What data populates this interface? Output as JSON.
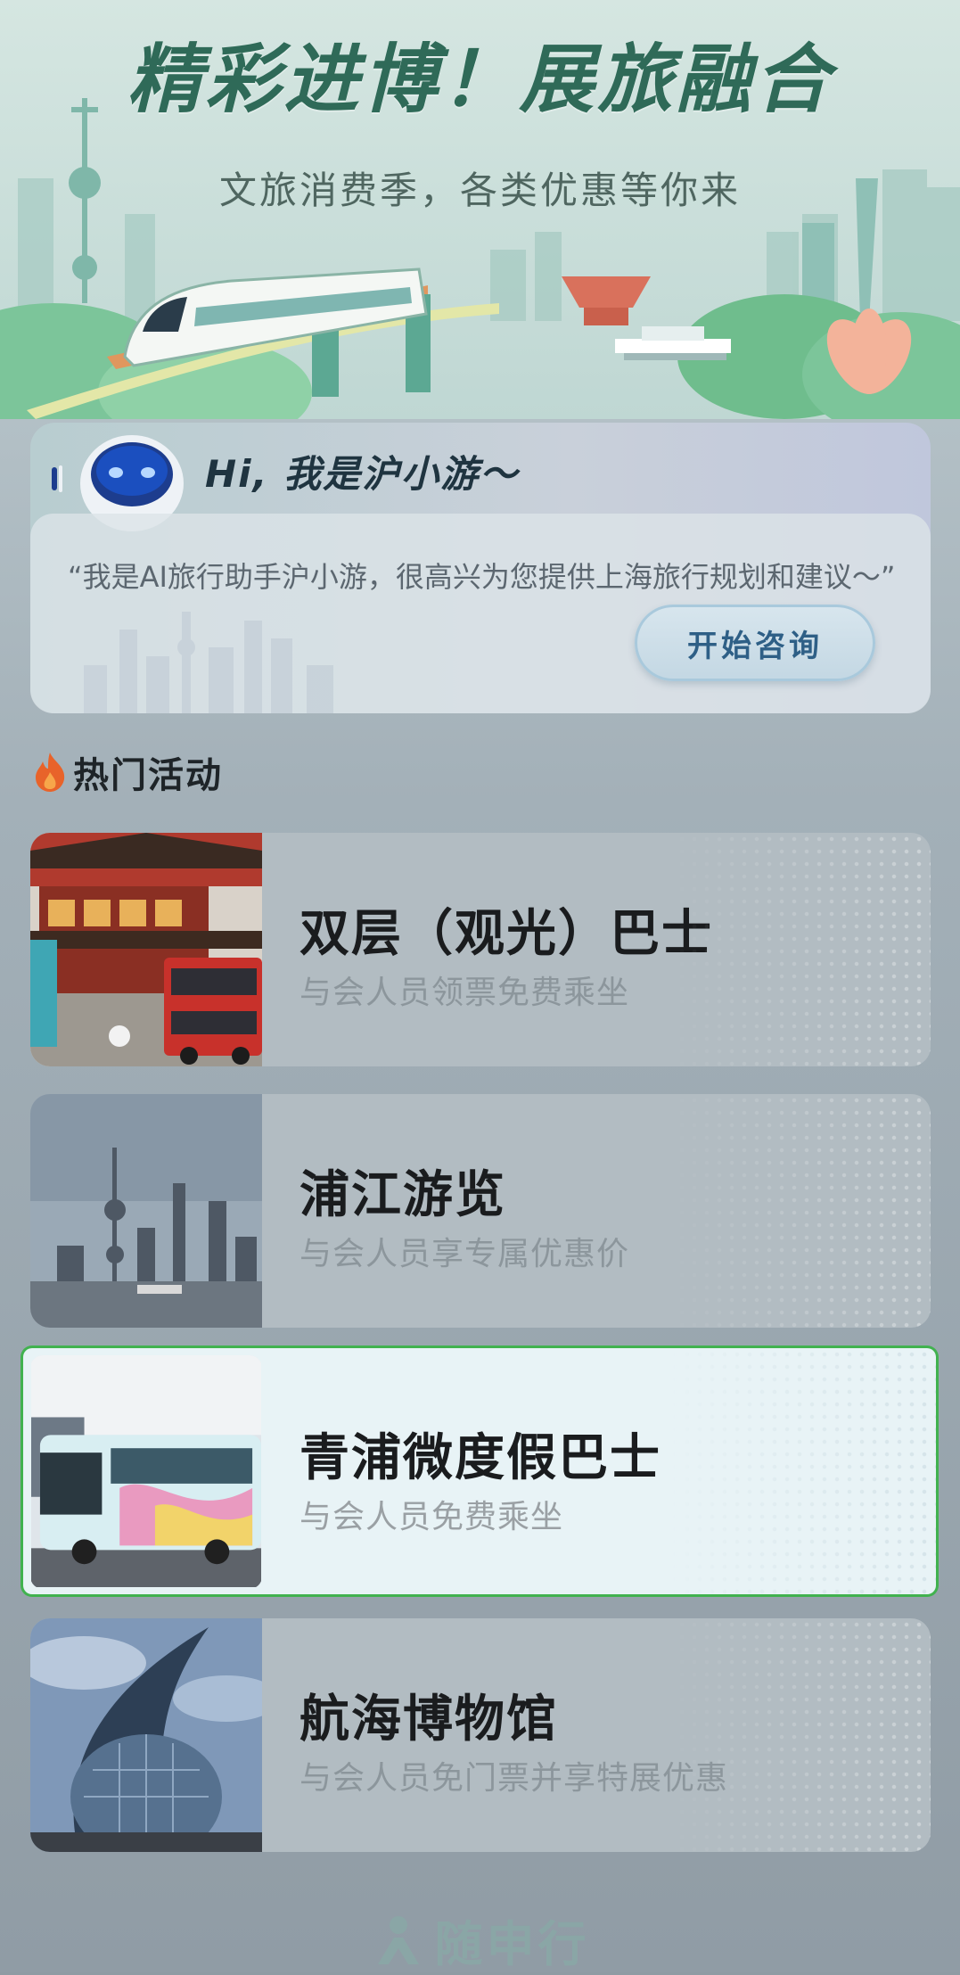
{
  "banner": {
    "title": "精彩进博！展旅融合",
    "subtitle": "文旅消费季，各类优惠等你来"
  },
  "assistant": {
    "greeting": "Hi, 我是沪小游～",
    "intro": "“我是AI旅行助手沪小游，很高兴为您提供上海旅行规划和建议～”",
    "button_label": "开始咨询"
  },
  "section": {
    "icon": "flame-icon",
    "title": "热门活动"
  },
  "activities": [
    {
      "title": "双层（观光）巴士",
      "description": "与会人员领票免费乘坐",
      "image": "double-decker-bus-photo"
    },
    {
      "title": "浦江游览",
      "description": "与会人员享专属优惠价",
      "image": "huangpu-river-skyline-photo"
    },
    {
      "title": "青浦微度假巴士",
      "description": "与会人员免费乘坐",
      "image": "qingpu-tour-bus-photo",
      "highlighted": true
    },
    {
      "title": "航海博物馆",
      "description": "与会人员免门票并享特展优惠",
      "image": "maritime-museum-photo"
    }
  ],
  "footer": {
    "brand": "随申行",
    "icon": "person-logo-icon"
  },
  "colors": {
    "highlight_border": "#41b24f",
    "banner_title": "#2f6a58",
    "button_text": "#2e5f86"
  }
}
